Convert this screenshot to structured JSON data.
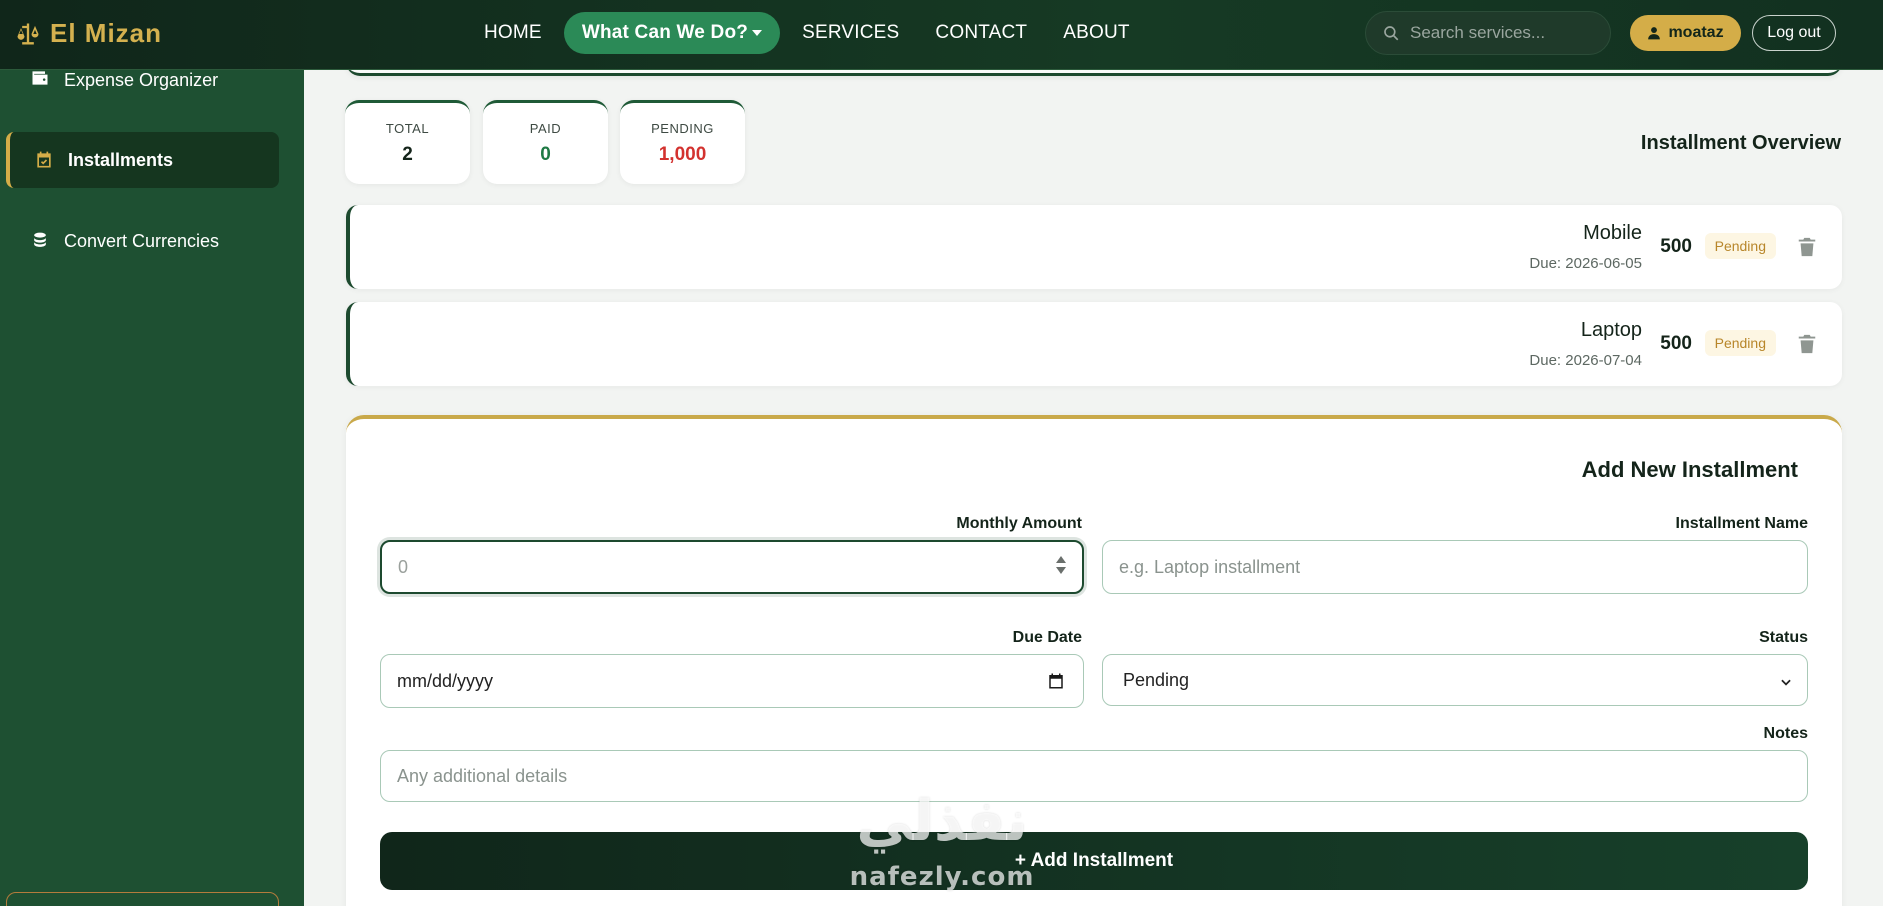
{
  "brand": {
    "name": "El Mizan",
    "icon": "scale-icon",
    "color": "#d4b14f"
  },
  "nav": {
    "links": [
      {
        "label": "HOME"
      },
      {
        "label": "What Can We Do?",
        "active": true,
        "dropdown": true
      },
      {
        "label": "SERVICES"
      },
      {
        "label": "CONTACT"
      },
      {
        "label": "ABOUT"
      }
    ],
    "search_placeholder": "Search services...",
    "user_label": "moataz",
    "logout_label": "Log out"
  },
  "sidebar": {
    "items": [
      {
        "label": "Expense Organizer",
        "icon": "wallet-icon"
      },
      {
        "label": "Installments",
        "icon": "calendar-icon",
        "active": true
      },
      {
        "label": "Convert Currencies",
        "icon": "coins-icon"
      }
    ]
  },
  "stats": [
    {
      "label": "TOTAL",
      "value": "2",
      "color": "#14241a"
    },
    {
      "label": "PAID",
      "value": "0",
      "color": "#1f7a45"
    },
    {
      "label": "PENDING",
      "value": "1,000",
      "color": "#d3322f"
    }
  ],
  "overview_title": "Installment Overview",
  "installments": [
    {
      "name": "Mobile",
      "due": "Due: 2026-06-05",
      "amount": "500",
      "status": "Pending"
    },
    {
      "name": "Laptop",
      "due": "Due: 2026-07-04",
      "amount": "500",
      "status": "Pending"
    }
  ],
  "form": {
    "title": "Add New Installment",
    "monthly_amount_label": "Monthly Amount",
    "monthly_amount_value": "0",
    "installment_name_label": "Installment Name",
    "installment_name_placeholder": "e.g. Laptop installment",
    "due_date_label": "Due Date",
    "due_date_placeholder": "mm/dd/yyyy",
    "status_label": "Status",
    "status_value": "Pending",
    "notes_label": "Notes",
    "notes_placeholder": "Any additional details",
    "submit_label": "+ Add Installment"
  },
  "watermark": {
    "arabic": "نفذلي",
    "latin": "nafezly.com"
  }
}
